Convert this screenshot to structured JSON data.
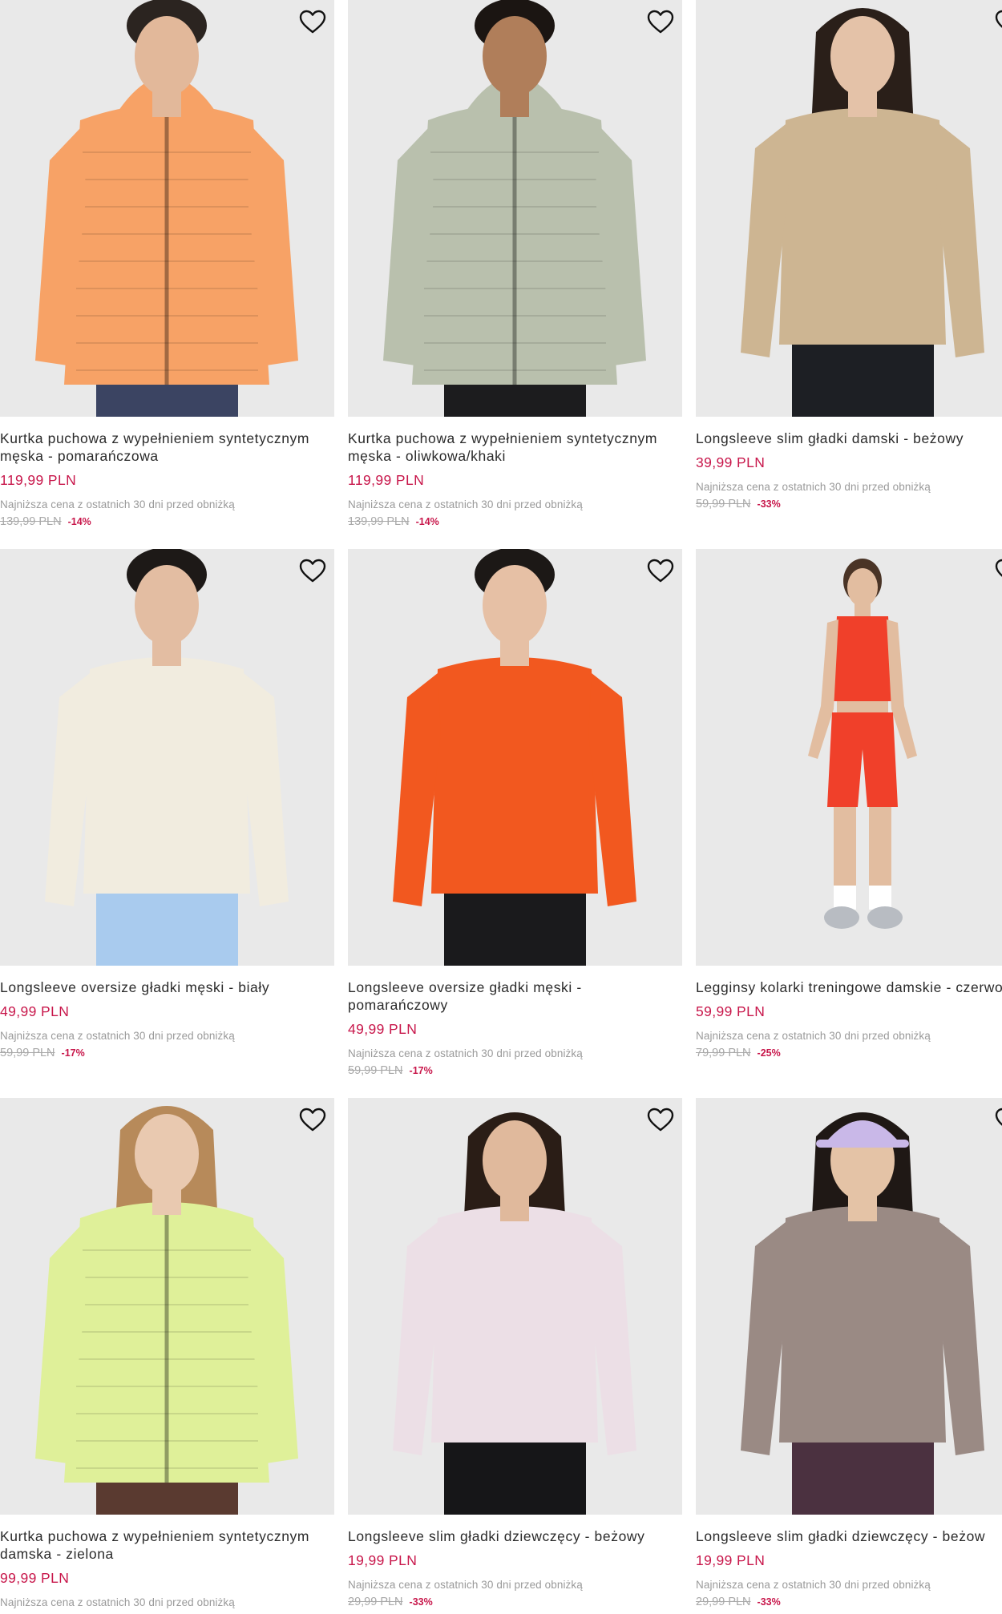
{
  "accent_color": "#c8174b",
  "favorite_icon": "heart-outline-icon",
  "products": [
    {
      "name": "Kurtka puchowa z wypełnieniem syntetycznym męska - pomarańczowa",
      "price": "119,99 PLN",
      "lowest_price_note": "Najniższa cena z ostatnich 30 dni przed obniżką",
      "old_price": "139,99 PLN",
      "discount": "-14%",
      "image": {
        "subject": "man-puffer-jacket",
        "garment": "#f7a266",
        "lower": "#3b4462",
        "skin": "#e2b89a",
        "hair": "#2b2420"
      }
    },
    {
      "name": "Kurtka puchowa z wypełnieniem syntetycznym męska - oliwkowa/khaki",
      "price": "119,99 PLN",
      "lowest_price_note": "Najniższa cena z ostatnich 30 dni przed obniżką",
      "old_price": "139,99 PLN",
      "discount": "-14%",
      "image": {
        "subject": "man-puffer-jacket",
        "garment": "#b9c0ad",
        "lower": "#1c1c1e",
        "skin": "#b07e5a",
        "hair": "#1b1512"
      }
    },
    {
      "name": "Longsleeve slim gładki damski - beżowy",
      "price": "39,99 PLN",
      "lowest_price_note": "Najniższa cena z ostatnich 30 dni przed obniżką",
      "old_price": "59,99 PLN",
      "discount": "-33%",
      "image": {
        "subject": "woman-longsleeve",
        "garment": "#cdb592",
        "lower": "#1d1f24",
        "skin": "#e4c2a8",
        "hair": "#2a1f19"
      }
    },
    {
      "name": "Longsleeve oversize gładki męski - biały",
      "price": "49,99 PLN",
      "lowest_price_note": "Najniższa cena z ostatnich 30 dni przed obniżką",
      "old_price": "59,99 PLN",
      "discount": "-17%",
      "image": {
        "subject": "man-longsleeve",
        "garment": "#f1ecdf",
        "lower": "#a9cbee",
        "skin": "#e3bda2",
        "hair": "#1d1917"
      }
    },
    {
      "name": "Longsleeve oversize gładki męski - pomarańczowy",
      "price": "49,99 PLN",
      "lowest_price_note": "Najniższa cena z ostatnich 30 dni przed obniżką",
      "old_price": "59,99 PLN",
      "discount": "-17%",
      "image": {
        "subject": "man-longsleeve",
        "garment": "#f2581f",
        "lower": "#1a1a1c",
        "skin": "#e6c0a5",
        "hair": "#1c1816"
      }
    },
    {
      "name": "Legginsy kolarki treningowe damskie - czerwone",
      "price": "59,99 PLN",
      "lowest_price_note": "Najniższa cena z ostatnich 30 dni przed obniżką",
      "old_price": "79,99 PLN",
      "discount": "-25%",
      "image": {
        "subject": "woman-shorts",
        "garment": "#f0402a",
        "lower": "#f0402a",
        "skin": "#e2bda0",
        "hair": "#4a3426"
      }
    },
    {
      "name": "Kurtka puchowa z wypełnieniem syntetycznym damska - zielona",
      "price": "99,99 PLN",
      "lowest_price_note": "Najniższa cena z ostatnich 30 dni przed obniżką",
      "old_price": "",
      "discount": "",
      "image": {
        "subject": "woman-puffer-jacket",
        "garment": "#dff099",
        "lower": "#5a3a30",
        "skin": "#e9c9b0",
        "hair": "#b78a5a"
      }
    },
    {
      "name": "Longsleeve slim gładki dziewczęcy - beżowy",
      "price": "19,99 PLN",
      "lowest_price_note": "Najniższa cena z ostatnich 30 dni przed obniżką",
      "old_price": "29,99 PLN",
      "discount": "-33%",
      "image": {
        "subject": "girl-longsleeve",
        "garment": "#ecdfe6",
        "lower": "#161618",
        "skin": "#e0b99c",
        "hair": "#2a1d16"
      }
    },
    {
      "name": "Longsleeve slim gładki dziewczęcy - beżow",
      "price": "19,99 PLN",
      "lowest_price_note": "Najniższa cena z ostatnich 30 dni przed obniżką",
      "old_price": "29,99 PLN",
      "discount": "-33%",
      "image": {
        "subject": "girl-longsleeve-cap",
        "garment": "#9a8a84",
        "lower": "#4b3140",
        "skin": "#e4c3a6",
        "hair": "#1f1815",
        "cap": "#c9b8e8"
      }
    }
  ]
}
